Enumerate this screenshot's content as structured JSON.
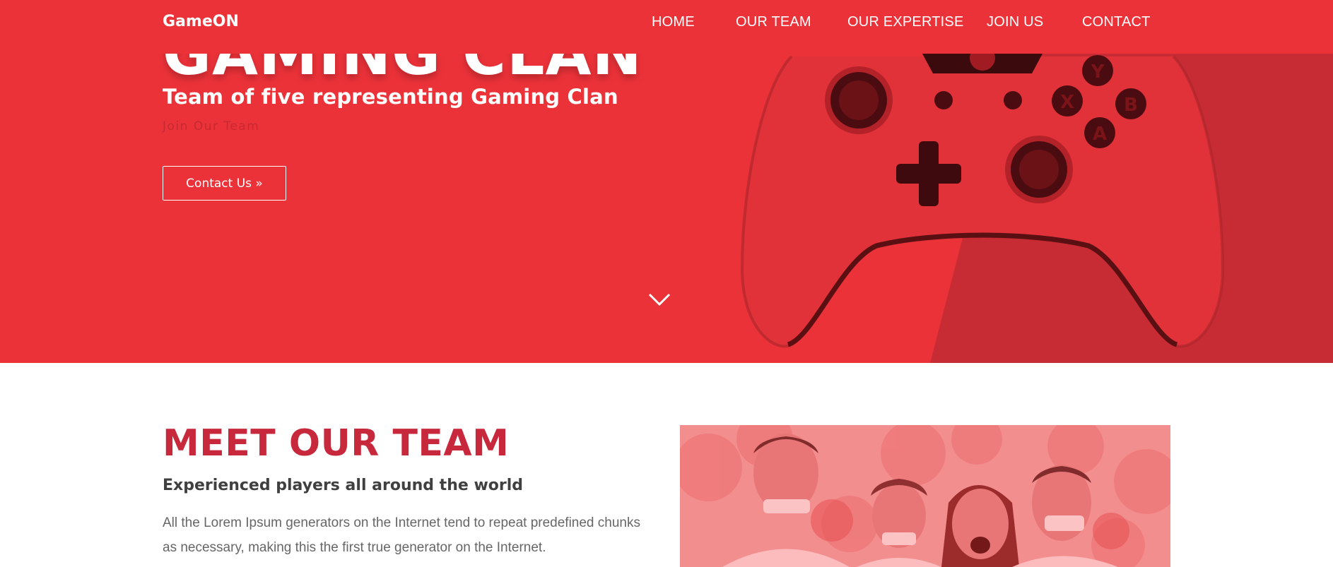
{
  "brand": {
    "name": "GameON"
  },
  "nav": {
    "items": [
      {
        "label": "HOME"
      },
      {
        "label": "OUR TEAM"
      },
      {
        "label": "OUR EXPERTISE"
      },
      {
        "label": "JOIN US"
      },
      {
        "label": "CONTACT"
      }
    ]
  },
  "hero": {
    "title": "GAMING CLAN",
    "subtitle": "Team of five representing Gaming Clan",
    "tagline": "Join Our Team",
    "cta_label": "Contact Us »",
    "controller_buttons": {
      "y": "Y",
      "x": "X",
      "b": "B",
      "a": "A"
    },
    "scroll_icon": "chevron-down-icon"
  },
  "team": {
    "title": "MEET OUR TEAM",
    "subtitle": "Experienced players all around the world",
    "text": "All the Lorem Ipsum generators on the Internet tend to repeat predefined chunks as necessary, making this the first true generator on the Internet."
  },
  "colors": {
    "primary": "#ec3239",
    "dark_red": "#c8283b",
    "text": "#404040"
  }
}
